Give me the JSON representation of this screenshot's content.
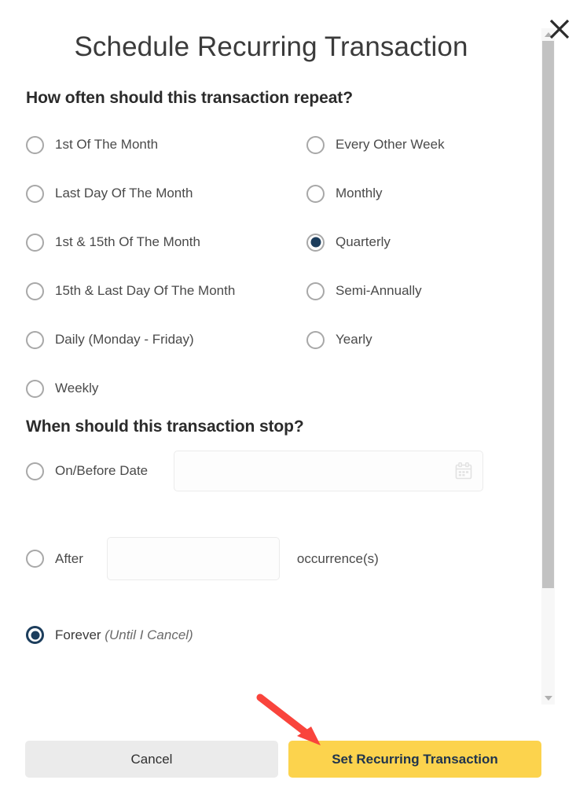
{
  "dialog": {
    "title": "Schedule Recurring Transaction",
    "close_icon": "close-x-icon"
  },
  "scrollbar": {
    "up_icon": "scroll-up-arrow-icon",
    "down_icon": "scroll-down-arrow-icon"
  },
  "frequency": {
    "heading": "How often should this transaction repeat?",
    "left_options": [
      {
        "label": "1st Of The Month",
        "selected": false
      },
      {
        "label": "Last Day Of The Month",
        "selected": false
      },
      {
        "label": "1st & 15th Of The Month",
        "selected": false
      },
      {
        "label": "15th & Last Day Of The Month",
        "selected": false
      },
      {
        "label": "Daily (Monday - Friday)",
        "selected": false
      },
      {
        "label": "Weekly",
        "selected": false
      }
    ],
    "right_options": [
      {
        "label": "Every Other Week",
        "selected": false
      },
      {
        "label": "Monthly",
        "selected": false
      },
      {
        "label": "Quarterly",
        "selected": true
      },
      {
        "label": "Semi-Annually",
        "selected": false
      },
      {
        "label": "Yearly",
        "selected": false
      }
    ],
    "selected_value": "Quarterly"
  },
  "stop": {
    "heading": "When should this transaction stop?",
    "on_before_date": {
      "label": "On/Before Date",
      "selected": false,
      "input_value": "",
      "input_placeholder": "",
      "calendar_icon": "calendar-icon"
    },
    "after": {
      "label": "After",
      "selected": false,
      "input_value": "",
      "input_placeholder": "",
      "suffix_label": "occurrence(s)"
    },
    "forever": {
      "label": "Forever ",
      "note": "(Until I Cancel)",
      "selected": true
    },
    "selected_value": "Forever (Until I Cancel)"
  },
  "footer": {
    "cancel_label": "Cancel",
    "submit_label": "Set Recurring Transaction"
  },
  "annotation": {
    "arrow_icon": "red-arrow-pointer-icon",
    "arrow_color": "#f9443c",
    "points_to": "Set Recurring Transaction"
  },
  "colors": {
    "primary_button": "#fcd34d",
    "primary_button_text": "#20344c",
    "cancel_button": "#ebebeb",
    "radio_selected": "#1c3d5c",
    "title_text": "#3b3b3b"
  }
}
